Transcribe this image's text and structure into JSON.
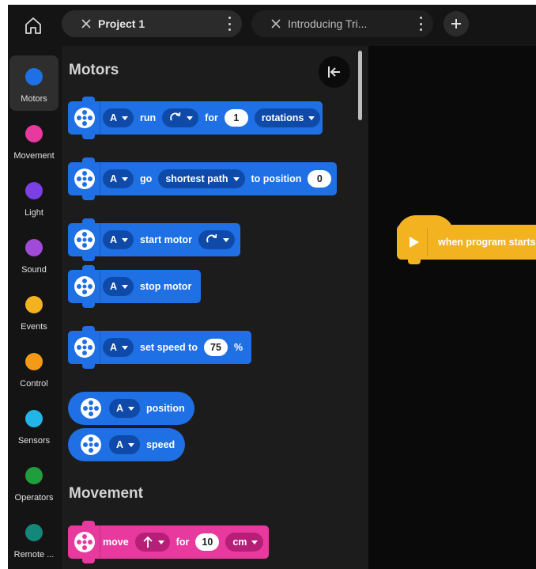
{
  "tabs": [
    {
      "label": "Project 1",
      "active": true
    },
    {
      "label": "Introducing Tri...",
      "active": false
    }
  ],
  "icons": {
    "home": "home-icon",
    "close": "close-icon",
    "more": "kebab-menu-icon",
    "add": "plus-icon",
    "collapse": "collapse-left-icon",
    "motor": "motor-icon",
    "movement": "movement-icon",
    "direction_clockwise": "clockwise-arrow-icon",
    "direction_up": "up-arrow-icon",
    "play": "play-icon"
  },
  "sidebar": {
    "categories": [
      {
        "label": "Motors",
        "color": "#1f6fe5",
        "selected": true
      },
      {
        "label": "Movement",
        "color": "#e8399f",
        "selected": false
      },
      {
        "label": "Light",
        "color": "#7b3fe4",
        "selected": false
      },
      {
        "label": "Sound",
        "color": "#a04ad8",
        "selected": false
      },
      {
        "label": "Events",
        "color": "#f3b321",
        "selected": false
      },
      {
        "label": "Control",
        "color": "#f59a16",
        "selected": false
      },
      {
        "label": "Sensors",
        "color": "#22b5e8",
        "selected": false
      },
      {
        "label": "Operators",
        "color": "#1f9e3d",
        "selected": false
      },
      {
        "label": "Remote ...",
        "color": "#13877a",
        "selected": false
      }
    ]
  },
  "palette": {
    "sections": {
      "motors_title": "Motors",
      "movement_title": "Movement"
    },
    "blocks": {
      "run": {
        "port": "A",
        "word1": "run",
        "word2": "for",
        "amount": "1",
        "unit": "rotations"
      },
      "go_to_position": {
        "port": "A",
        "word1": "go",
        "path": "shortest path",
        "word2": "to position",
        "position": "0"
      },
      "start_motor": {
        "port": "A",
        "word1": "start motor"
      },
      "stop_motor": {
        "port": "A",
        "word1": "stop motor"
      },
      "set_speed": {
        "port": "A",
        "word1": "set speed to",
        "speed": "75",
        "unit": "%"
      },
      "position_reporter": {
        "port": "A",
        "word1": "position"
      },
      "speed_reporter": {
        "port": "A",
        "word1": "speed"
      },
      "move": {
        "word1": "move",
        "word2": "for",
        "amount": "10",
        "unit": "cm"
      }
    }
  },
  "canvas": {
    "hat_block": {
      "label": "when program starts"
    }
  },
  "colors": {
    "background": "#141414",
    "palette": "#1c1c1c",
    "canvas": "#0a0a0a",
    "motors": "#1f6fe5",
    "movement": "#e8399f",
    "events": "#f3b321"
  }
}
